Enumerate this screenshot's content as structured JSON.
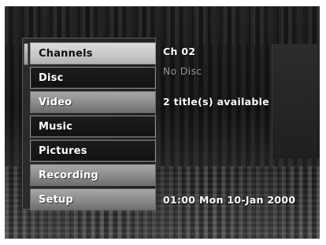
{
  "menu": {
    "items": [
      {
        "label": "Channels",
        "state": "selected"
      },
      {
        "label": "Disc",
        "state": "dark"
      },
      {
        "label": "Video",
        "state": "light"
      },
      {
        "label": "Music",
        "state": "dark"
      },
      {
        "label": "Pictures",
        "state": "dark"
      },
      {
        "label": "Recording",
        "state": "light"
      },
      {
        "label": "Setup",
        "state": "light"
      }
    ]
  },
  "info": {
    "channel": "Ch 02",
    "disc_status": "No Disc",
    "video_status": "2 title(s) available",
    "clock": "01:00 Mon 10-Jan 2000"
  },
  "colors": {
    "selected_item": "#c7c7c7",
    "light_item": "#8a8a8a",
    "dark_item": "#151515",
    "text": "#ffffff"
  }
}
